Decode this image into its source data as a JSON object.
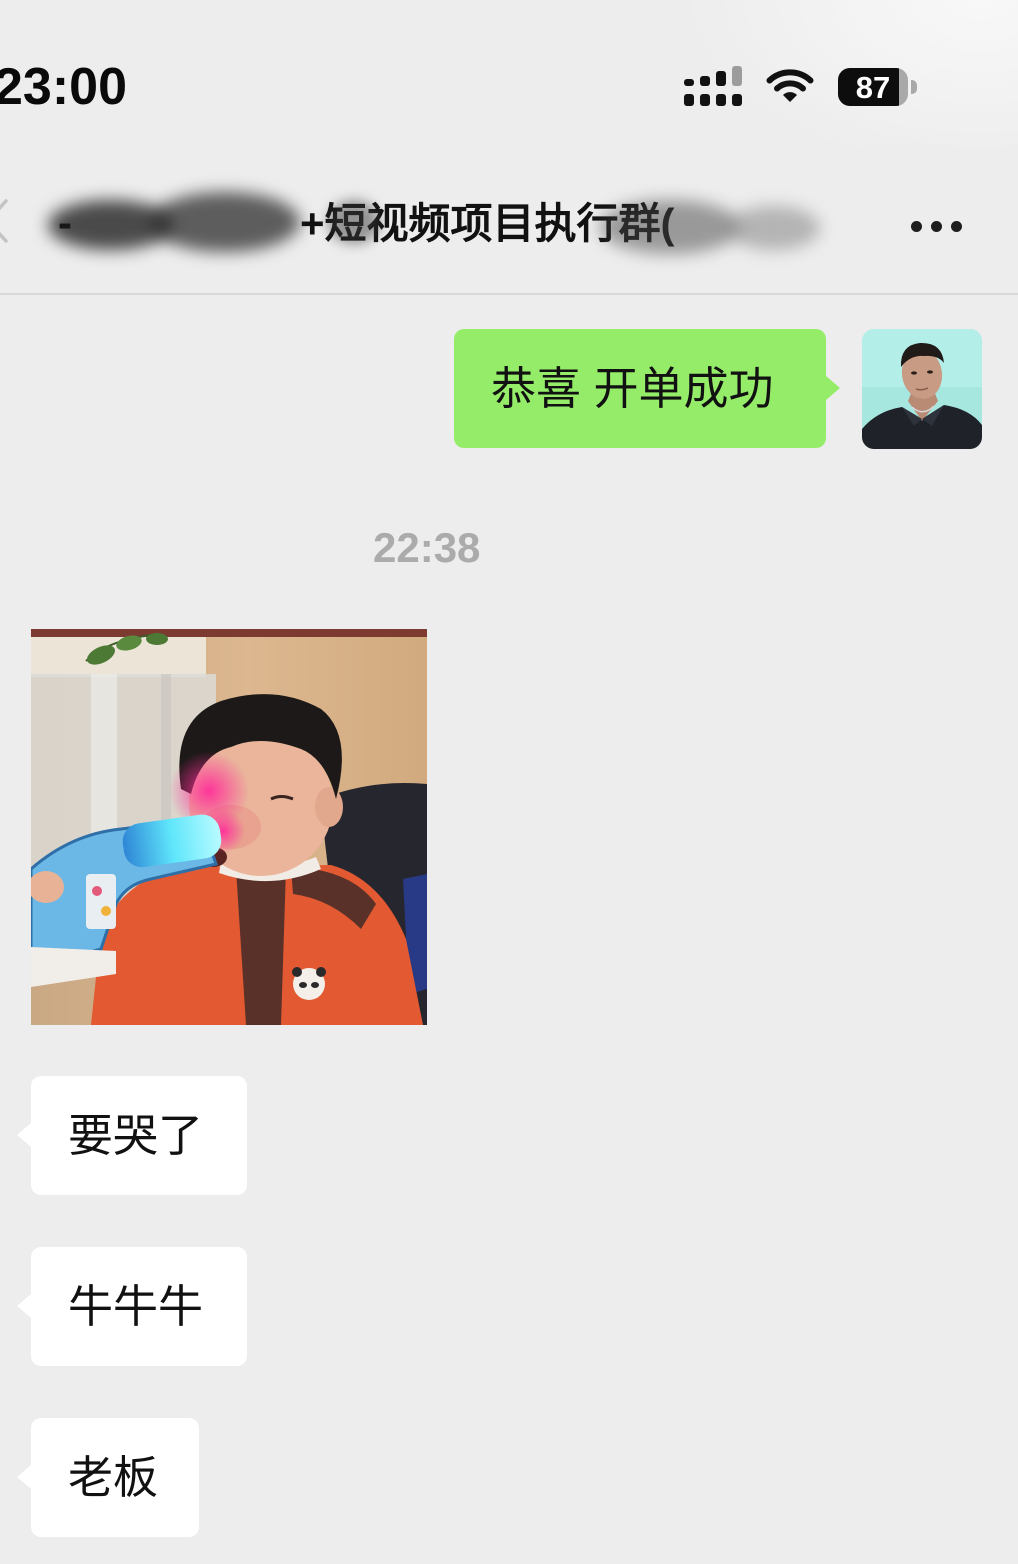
{
  "status_bar": {
    "time": "23:00",
    "signal": {
      "icon": "cellular-signal-icon",
      "rows": [
        {
          "bars": 3,
          "max_bars": 4
        },
        {
          "bars": 4,
          "max_bars": 4
        }
      ]
    },
    "wifi": {
      "icon": "wifi-icon"
    },
    "battery": {
      "icon": "battery-icon",
      "label": "87",
      "level": 0.87
    }
  },
  "header": {
    "back_icon": "chevron-left-icon",
    "title_prefix": "-",
    "title": "+短视频项目执行群(",
    "more_icon": "more-dots-icon"
  },
  "messages": [
    {
      "side": "sent",
      "type": "text",
      "text": "恭喜 开单成功"
    },
    {
      "type": "timestamp",
      "text": "22:38"
    },
    {
      "side": "received",
      "type": "image"
    },
    {
      "side": "received",
      "type": "text",
      "text": "要哭了"
    },
    {
      "side": "received",
      "type": "text",
      "text": "牛牛牛"
    },
    {
      "side": "received",
      "type": "text",
      "text": "老板"
    }
  ],
  "colors": {
    "background": "#EDEDED",
    "sent_bubble": "#95EC69",
    "received_bubble": "#FFFFFF",
    "timestamp": "#ABABAB",
    "text": "#111111",
    "signal_active": "#111111",
    "signal_inactive": "#9C9C9C"
  }
}
